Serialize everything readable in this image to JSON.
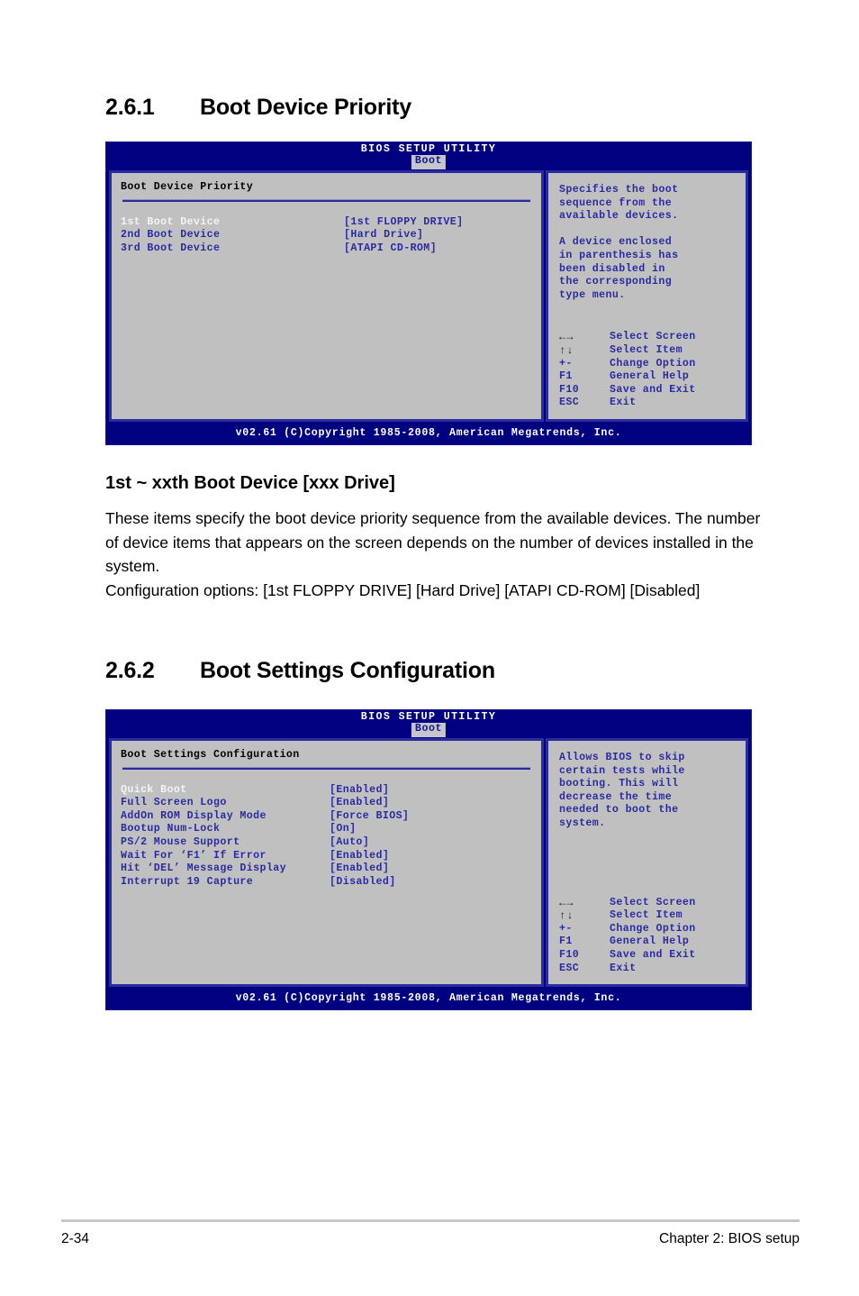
{
  "sections": [
    {
      "number": "2.6.1",
      "title": "Boot Device Priority"
    },
    {
      "number": "2.6.2",
      "title": "Boot Settings Configuration"
    }
  ],
  "bios_common": {
    "utility_title": "BIOS SETUP UTILITY",
    "tab_label": "Boot",
    "footer": "v02.61 (C)Copyright 1985-2008, American Megatrends, Inc.",
    "legend": [
      {
        "key": "←→",
        "action": "Select Screen",
        "glyph": true
      },
      {
        "key": "↑↓",
        "action": "Select Item",
        "glyph": true
      },
      {
        "key": "+-",
        "action": "Change Option",
        "glyph": false
      },
      {
        "key": "F1",
        "action": "General Help",
        "glyph": false
      },
      {
        "key": "F10",
        "action": "Save and Exit",
        "glyph": false
      },
      {
        "key": "ESC",
        "action": "Exit",
        "glyph": false
      }
    ]
  },
  "screen1": {
    "panel_title": "Boot Device Priority",
    "items": [
      {
        "label": "1st Boot Device",
        "value": "[1st FLOPPY DRIVE]",
        "selected": true
      },
      {
        "label": "2nd Boot Device",
        "value": "[Hard Drive]",
        "selected": false
      },
      {
        "label": "3rd Boot Device",
        "value": "[ATAPI CD-ROM]",
        "selected": false
      }
    ],
    "help_1": "Specifies the boot\nsequence from the\navailable devices.",
    "help_2": "A device enclosed\nin parenthesis has\nbeen disabled in\nthe corresponding\ntype menu."
  },
  "screen2": {
    "panel_title": "Boot Settings Configuration",
    "items": [
      {
        "label": "Quick Boot",
        "value": "[Enabled]",
        "selected": true
      },
      {
        "label": "Full Screen Logo",
        "value": "[Enabled]",
        "selected": false
      },
      {
        "label": "AddOn ROM Display Mode",
        "value": "[Force BIOS]",
        "selected": false
      },
      {
        "label": "Bootup Num-Lock",
        "value": "[On]",
        "selected": false
      },
      {
        "label": "PS/2 Mouse Support",
        "value": "[Auto]",
        "selected": false
      },
      {
        "label": "Wait For ‘F1’ If Error",
        "value": "[Enabled]",
        "selected": false
      },
      {
        "label": "Hit ‘DEL’ Message Display",
        "value": "[Enabled]",
        "selected": false
      },
      {
        "label": "Interrupt 19 Capture",
        "value": "[Disabled]",
        "selected": false
      }
    ],
    "help_1": "Allows BIOS to skip\ncertain tests while\nbooting. This will\ndecrease the time\nneeded to boot the\nsystem."
  },
  "body": {
    "heading": "1st ~ xxth Boot Device [xxx Drive]",
    "paragraph": "These items specify the boot device priority sequence from the available devices. The number of device items that appears on the screen depends on the number of devices installed in the system.\nConfiguration options: [1st FLOPPY DRIVE] [Hard Drive] [ATAPI CD-ROM] [Disabled]"
  },
  "footer": {
    "page_number": "2-34",
    "chapter": "Chapter 2: BIOS setup"
  },
  "colors": {
    "bios_blue": "#000080",
    "bios_gray": "#c0c0c0",
    "bios_text_blue": "#2b2ba0",
    "highlight": "#f4f4f4"
  }
}
